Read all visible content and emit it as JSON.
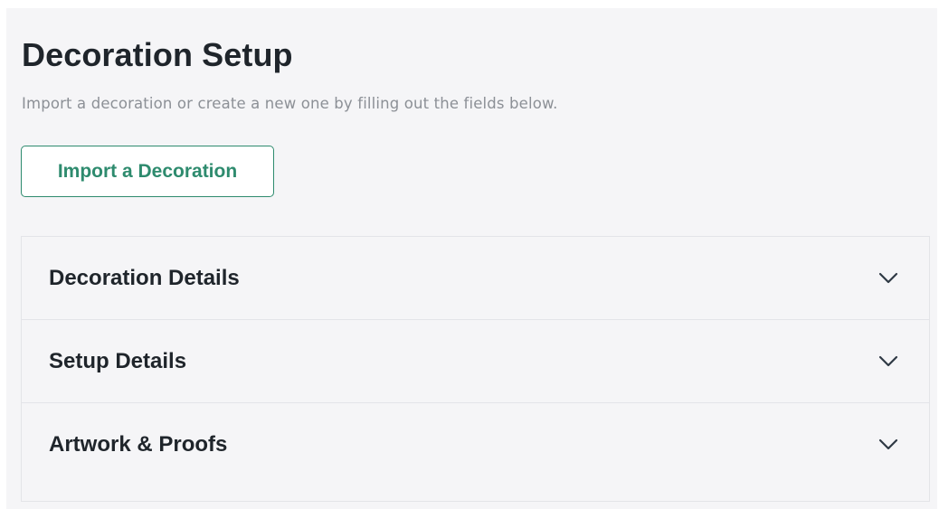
{
  "page": {
    "title": "Decoration Setup",
    "subtitle": "Import a decoration or create a new one by filling out the fields below."
  },
  "import_button": {
    "label": "Import a Decoration"
  },
  "sections": [
    {
      "label": "Decoration Details",
      "icon": "chevron-down-icon",
      "expanded": false
    },
    {
      "label": "Setup Details",
      "icon": "chevron-down-icon",
      "expanded": false
    },
    {
      "label": "Artwork & Proofs",
      "icon": "chevron-down-icon",
      "expanded": false
    }
  ],
  "colors": {
    "accent": "#2e8b6e",
    "background": "#f5f5f7",
    "title": "#1f252b",
    "subtitle": "#8c9096"
  }
}
